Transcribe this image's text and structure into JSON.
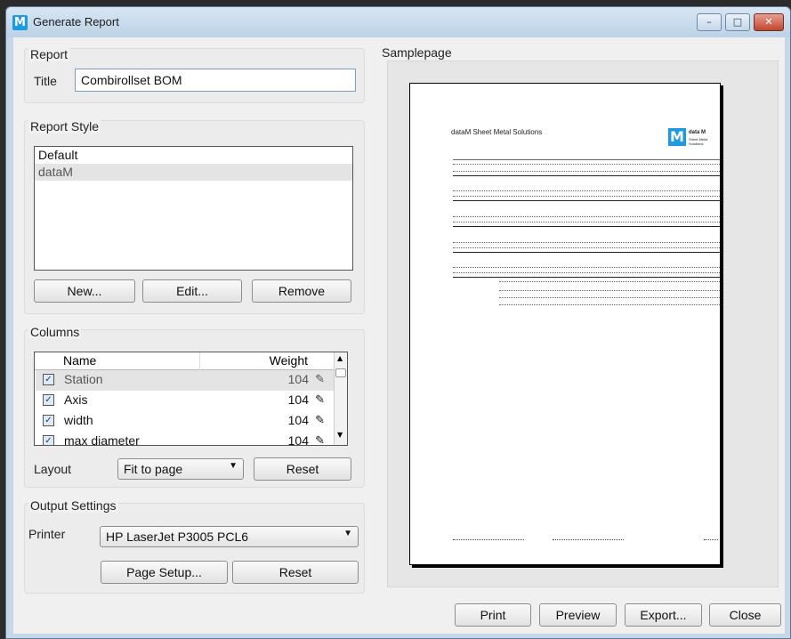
{
  "window": {
    "title": "Generate Report",
    "controls": {
      "minimize": "–",
      "maximize": "□",
      "close": "✕"
    }
  },
  "report": {
    "group_title": "Report",
    "title_label": "Title",
    "title_value": "Combirollset BOM"
  },
  "report_style": {
    "group_title": "Report Style",
    "items": [
      "Default",
      "dataM"
    ],
    "selected": "dataM",
    "new_label": "New...",
    "edit_label": "Edit...",
    "remove_label": "Remove"
  },
  "columns": {
    "group_title": "Columns",
    "header_name": "Name",
    "header_weight": "Weight",
    "rows": [
      {
        "name": "Station",
        "weight": "104",
        "checked": true
      },
      {
        "name": "Axis",
        "weight": "104",
        "checked": true
      },
      {
        "name": "width",
        "weight": "104",
        "checked": true
      },
      {
        "name": "max diameter",
        "weight": "104",
        "checked": true
      }
    ],
    "layout_label": "Layout",
    "layout_value": "Fit to page",
    "reset_label": "Reset"
  },
  "output": {
    "group_title": "Output Settings",
    "printer_label": "Printer",
    "printer_value": "HP LaserJet P3005 PCL6",
    "page_setup_label": "Page Setup...",
    "reset_label": "Reset"
  },
  "sample": {
    "group_title": "Samplepage",
    "heading": "dataM Sheet Metal Solutions",
    "logo_text": "data M",
    "logo_sub": "Sheet Metal Solutions"
  },
  "footer": {
    "print_label": "Print",
    "preview_label": "Preview",
    "export_label": "Export...",
    "close_label": "Close"
  },
  "colors": {
    "title_bar": "#bcd2e6",
    "close_button": "#c0462e",
    "app_icon": "#1e9be0"
  }
}
